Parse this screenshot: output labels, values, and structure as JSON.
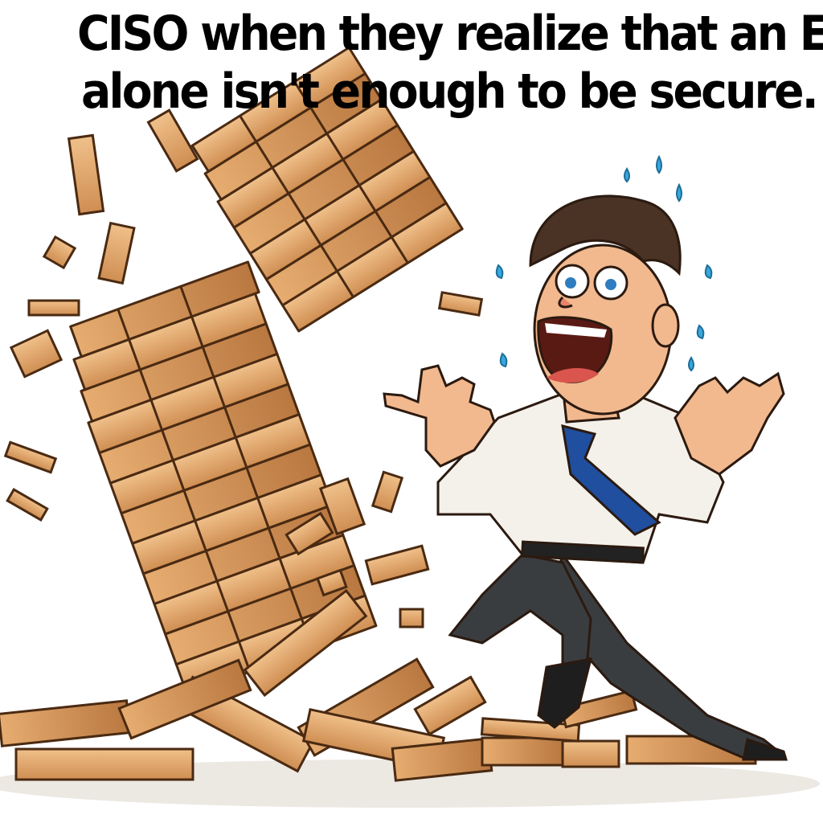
{
  "caption": {
    "line1": "CISO when they realize that an EDR",
    "line2": "alone isn't enough to be secure."
  },
  "illustration": {
    "subject": "panicked-man-icon",
    "tower": "falling-jenga-tower-icon",
    "colors": {
      "wood_light": "#e9b47a",
      "wood_mid": "#d4955a",
      "wood_dark": "#9c6232",
      "outline": "#4a2a12",
      "shirt": "#f4f1ea",
      "tie": "#1f4f9e",
      "pants": "#3a3d40",
      "skin": "#f2b88e",
      "hair": "#4a3324",
      "sweat": "#3aa6dc"
    }
  }
}
